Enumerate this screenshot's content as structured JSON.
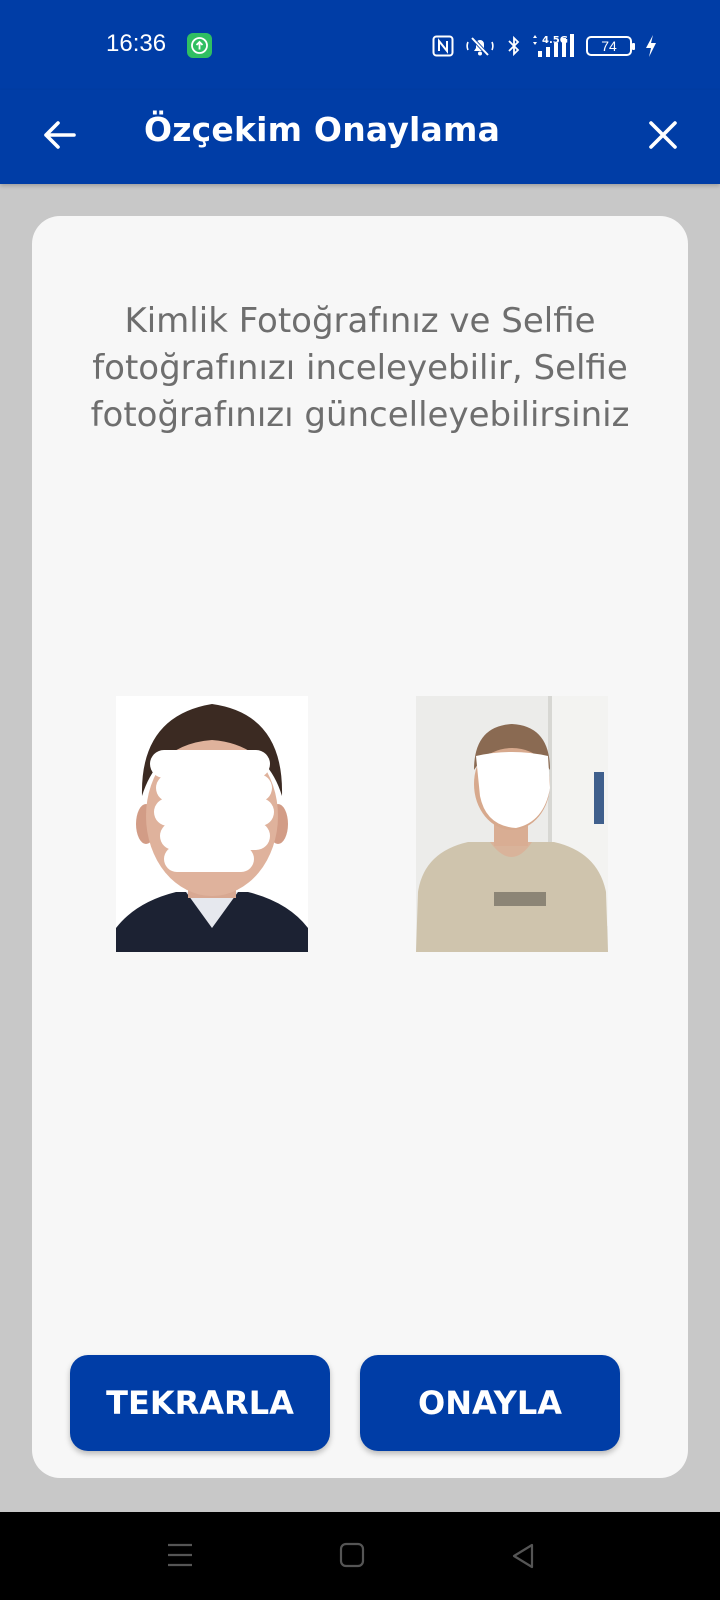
{
  "status_bar": {
    "time": "16:36",
    "network_label": "4.5G",
    "battery_level": "74",
    "icons": [
      "upload-app-icon",
      "nfc-icon",
      "mute-icon",
      "bluetooth-icon",
      "signal-icon",
      "battery-icon",
      "charging-icon"
    ]
  },
  "app_bar": {
    "title": "Özçekim Onaylama",
    "back_icon": "arrow-left-icon",
    "close_icon": "close-icon",
    "background_color": "#003da6"
  },
  "card": {
    "message": "Kimlik Fotoğrafınız ve Selfie fotoğrafınızı inceleyebilir, Selfie fotoğrafınızı güncelleyebilirsiniz",
    "photos": [
      "id-photo",
      "selfie-photo"
    ]
  },
  "buttons": {
    "retry_label": "TEKRARLA",
    "confirm_label": "ONAYLA",
    "color": "#003da6"
  },
  "nav_bar": {
    "icons": [
      "menu-icon",
      "home-icon",
      "back-triangle-icon"
    ]
  }
}
